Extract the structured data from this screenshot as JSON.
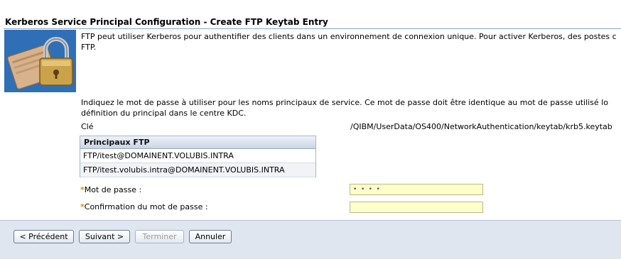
{
  "wizard": {
    "title": "Kerberos Service Principal Configuration - Create FTP Keytab Entry",
    "intro_line1": "FTP peut utiliser Kerberos pour authentifier des clients dans un environnement de connexion unique. Pour activer Kerberos, des postes c",
    "intro_line2": "FTP.",
    "password_line1": "Indiquez le mot de passe à utiliser pour les noms principaux de service. Ce mot de passe doit être identique au mot de passe utilisé lo",
    "password_line2": "définition du principal dans le centre KDC.",
    "key_label": "Clé",
    "key_value": "/QIBM/UserData/OS400/NetworkAuthentication/keytab/krb5.keytab"
  },
  "principals_table": {
    "header": "Principaux FTP",
    "rows": [
      "FTP/itest@DOMAINENT.VOLUBIS.INTRA",
      "FTP/itest.volubis.intra@DOMAINENT.VOLUBIS.INTRA"
    ]
  },
  "form": {
    "required_mark": "*",
    "password_label": "Mot de passe :",
    "password_value": "• • • •",
    "confirm_label": "Confirmation du mot de passe :",
    "confirm_value": ""
  },
  "buttons": {
    "previous": "< Précédent",
    "next": "Suivant >",
    "finish": "Terminer",
    "cancel": "Annuler"
  },
  "colors": {
    "input_background": "#ffffcc",
    "button_bar": "#dfe6f0",
    "image_background": "#2f6fb6"
  }
}
